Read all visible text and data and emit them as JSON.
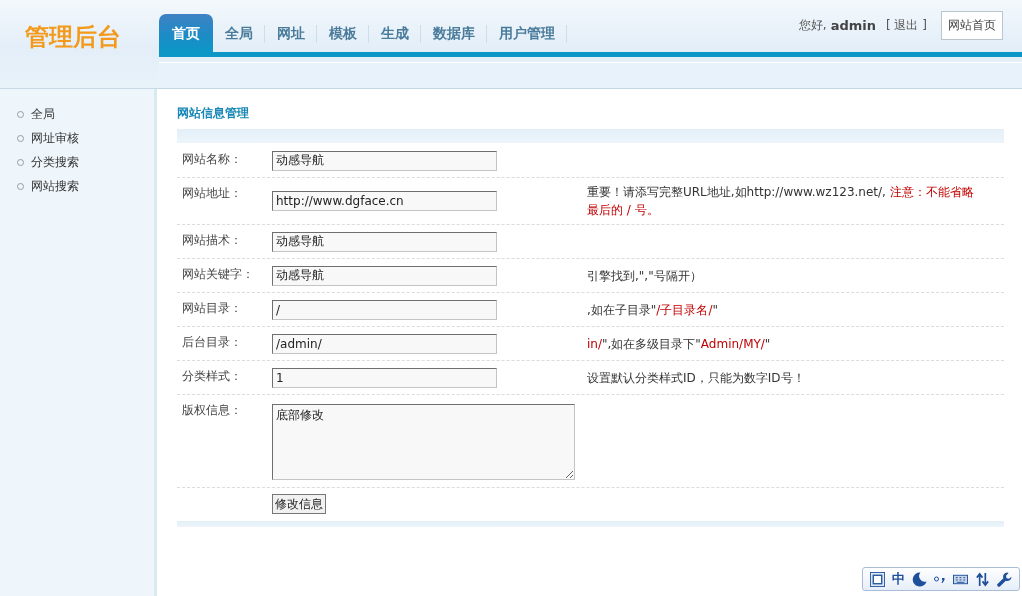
{
  "logo": {
    "text": "管理后台"
  },
  "nav_tabs": [
    {
      "label": "首页",
      "selected": true
    },
    {
      "label": "全局",
      "selected": false
    },
    {
      "label": "网址",
      "selected": false
    },
    {
      "label": "模板",
      "selected": false
    },
    {
      "label": "生成",
      "selected": false
    },
    {
      "label": "数据库",
      "selected": false
    },
    {
      "label": "用户管理",
      "selected": false
    }
  ],
  "user_bar": {
    "greeting": "您好,",
    "username": "admin",
    "logout": "[ 退出 ]",
    "home_button": "网站首页"
  },
  "sidebar": {
    "items": [
      {
        "label": "全局"
      },
      {
        "label": "网址审核"
      },
      {
        "label": "分类搜索"
      },
      {
        "label": "网站搜索"
      }
    ]
  },
  "panel": {
    "title": "网站信息管理",
    "fields": [
      {
        "kind": "input",
        "label": "网站名称：",
        "value": "动感导航"
      },
      {
        "kind": "input",
        "label": "网站地址：",
        "value": "http://www.dgface.cn",
        "hint": [
          {
            "text": "重要！请添写完整URL地址,如http://www.wz123.net/, ",
            "warning": false
          },
          {
            "text": "注意：不能省略最后的 / 号。",
            "warning": true
          }
        ]
      },
      {
        "kind": "input",
        "label": "网站描术：",
        "value": "动感导航"
      },
      {
        "kind": "input",
        "label": "网站关键字：",
        "value": "动感导航",
        "hint": [
          {
            "text": "引擎找到,\",\"号隔开）",
            "warning": false
          }
        ]
      },
      {
        "kind": "input",
        "label": "网站目录：",
        "value": "/",
        "hint": [
          {
            "text": ",如在子目录\"",
            "warning": false
          },
          {
            "text": "/子目录名/",
            "warning": true
          },
          {
            "text": "\"",
            "warning": false
          }
        ]
      },
      {
        "kind": "input",
        "label": "后台目录：",
        "value": "/admin/",
        "hint": [
          {
            "text": "in/",
            "warning": true
          },
          {
            "text": "\",如在多级目录下\"",
            "warning": false
          },
          {
            "text": "Admin/MY/",
            "warning": true
          },
          {
            "text": "\"",
            "warning": false
          }
        ]
      },
      {
        "kind": "input",
        "label": "分类样式：",
        "value": "1",
        "hint": [
          {
            "text": "设置默认分类样式ID，只能为数字ID号！",
            "warning": false
          }
        ]
      },
      {
        "kind": "textarea",
        "label": "版权信息：",
        "value": "底部修改"
      }
    ],
    "submit_button": "修改信息"
  },
  "ime_toolbar": {
    "mode": "中"
  }
}
